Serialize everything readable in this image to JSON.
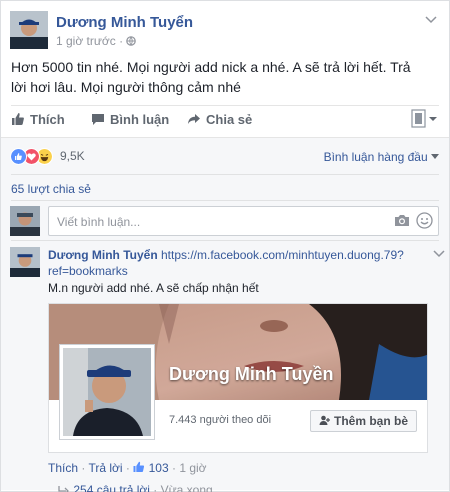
{
  "post": {
    "author": "Dương Minh Tuyển",
    "time": "1 giờ trước",
    "privacy_icon": "globe-icon",
    "text": "Hơn 5000 tin nhé. Mọi người add nick a nhé. A sẽ trả lời hết. Trả lời hơi lâu. Mọi người thông cảm nhé"
  },
  "actions": {
    "like": "Thích",
    "comment": "Bình luận",
    "share": "Chia sẻ"
  },
  "reactions": {
    "count": "9,5K",
    "icons": [
      "like-icon",
      "love-icon",
      "haha-icon"
    ],
    "order_label": "Bình luận hàng đầu"
  },
  "shares": "65 lượt chia sẻ",
  "composer": {
    "placeholder": "Viết bình luận..."
  },
  "comment": {
    "author": "Dương Minh Tuyển",
    "link": "https://m.facebook.com/minhtuyen.duong.79?ref=bookmarks",
    "text": "M.n người add nhé. A sẽ chấp nhận hết",
    "preview": {
      "name": "Dương Minh Tuyền",
      "followers": "7.443 người theo dõi",
      "add_friend": "Thêm bạn bè"
    },
    "like": "Thích",
    "reply": "Trả lời",
    "like_count": "103",
    "time": "1 giờ",
    "replies": "254 câu trả lời",
    "replies_time": "Vừa xong"
  },
  "colors": {
    "link": "#365899",
    "like_blue": "#5890ff",
    "love_red": "#f25268",
    "haha_yellow": "#fbd14b"
  }
}
